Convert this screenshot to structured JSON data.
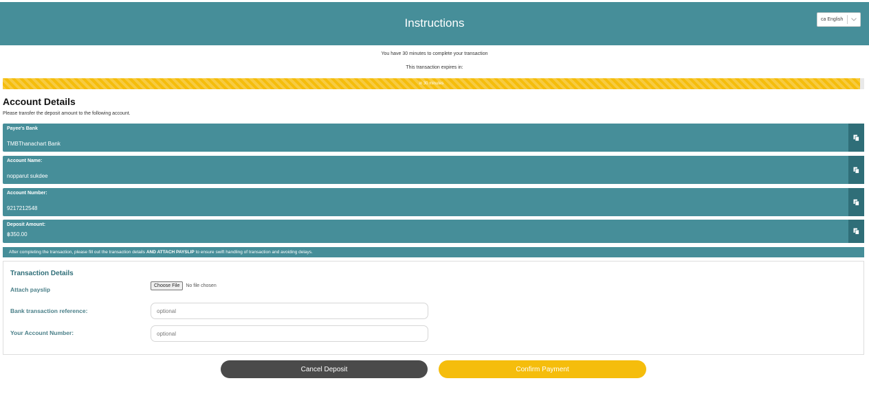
{
  "header": {
    "title": "Instructions"
  },
  "language": {
    "flag": "ca",
    "label": "English"
  },
  "notice": {
    "line1": "You have 30 minutes to complete your transaction",
    "line2": "This transaction expires in:"
  },
  "progress": {
    "text": "in 30 minutes",
    "fraction": 0.995,
    "color": "#f5bd0c"
  },
  "account": {
    "title": "Account Details",
    "subtitle": "Please transfer the deposit amount to the following account.",
    "fields": [
      {
        "label": "Payee's Bank",
        "value": "TMBThanachart Bank"
      },
      {
        "label": "Account Name:",
        "value": "nopparut sukdee"
      },
      {
        "label": "Account Number:",
        "value": "9217212548"
      },
      {
        "label": "Deposit Amount:",
        "value": "฿350.00"
      }
    ]
  },
  "info": {
    "pre": "After completing the transaction, please fill out the transaction details ",
    "bold": "AND ATTACH PAYSLIP",
    "post": " to ensure swift handling of transaction and avoiding delays."
  },
  "form": {
    "title": "Transaction Details",
    "attach_label": "Attach payslip",
    "file_button": "Choose File",
    "file_status": "No file chosen",
    "bank_ref_label": "Bank transaction reference:",
    "bank_ref_placeholder": "optional",
    "account_no_label": "Your Account Number:",
    "account_no_placeholder": "optional"
  },
  "buttons": {
    "cancel": "Cancel Deposit",
    "confirm": "Confirm Payment"
  },
  "colors": {
    "teal": "#468e99",
    "teal_dark": "#2f6e78",
    "yellow": "#f5bd0c",
    "dark_gray": "#4a4a4a"
  },
  "icons": {
    "copy": "copy-icon",
    "chevron": "chevron-down-icon"
  }
}
